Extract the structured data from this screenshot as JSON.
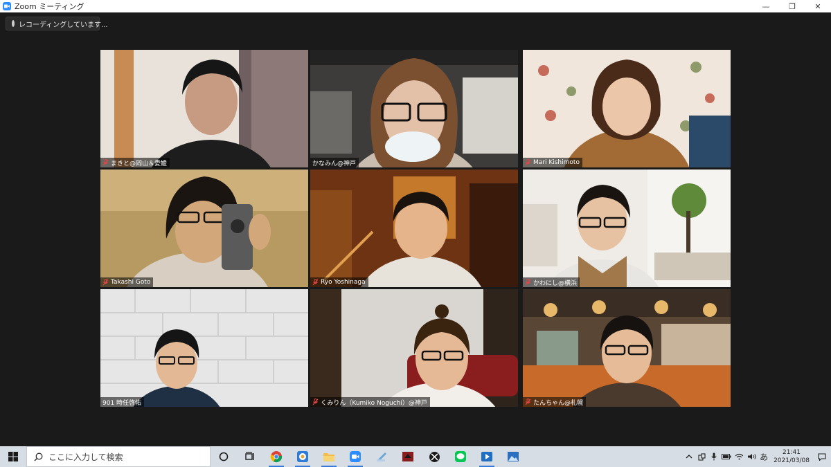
{
  "window": {
    "title": "Zoom ミーティング",
    "minimize": "—",
    "restore": "❐",
    "close": "✕"
  },
  "recording": {
    "label": "レコーディングしています..."
  },
  "participants": [
    {
      "name": "まきと@岡山＆愛媛",
      "muted": true,
      "active": false
    },
    {
      "name": "かなみん@神戸",
      "muted": false,
      "active": true
    },
    {
      "name": "Mari Kishimoto",
      "muted": true,
      "active": false
    },
    {
      "name": "Takashi Goto",
      "muted": true,
      "active": false
    },
    {
      "name": "Ryo Yoshinaga",
      "muted": true,
      "active": false
    },
    {
      "name": "かわにし@横浜",
      "muted": true,
      "active": false
    },
    {
      "name": "901 時任啓佑",
      "muted": false,
      "active": false
    },
    {
      "name": "くみりん（Kumiko Noguchi）@神戸",
      "muted": true,
      "active": false
    },
    {
      "name": "たんちゃん@札幌",
      "muted": true,
      "active": false
    }
  ],
  "taskbar": {
    "search_placeholder": "ここに入力して検索",
    "ime": "あ",
    "time": "21:41",
    "date": "2021/03/08"
  },
  "colors": {
    "active_speaker": "#d6e35a",
    "muted_icon": "#e04646",
    "zoom_blue": "#2D8CFF"
  }
}
